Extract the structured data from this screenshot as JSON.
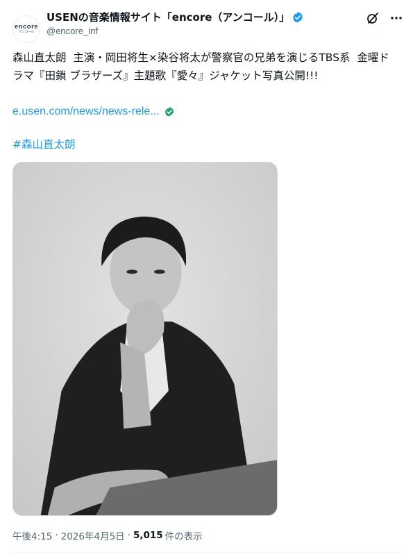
{
  "account": {
    "name": "USENの音楽情報サイト「encore（アンコール）」",
    "handle": "@encore_inf",
    "avatar_text": "encore",
    "avatar_subtext": "アンコール"
  },
  "tweet": {
    "text": "森山直太朗  主演・岡田将生×染谷将太が警察官の兄弟を演じるTBS系  金曜ドラマ『田鎖 ブラザーズ』主題歌『愛々』ジャケット写真公開!!!",
    "link": "e.usen.com/news/news-rele...",
    "hashtag": "#森山直太朗",
    "time": "午後4:15",
    "date": "2026年4月5日",
    "views_count": "5,015",
    "views_label": "件の表示"
  },
  "colors": {
    "accent": "#1d9bf0",
    "secondary_text": "#536471",
    "verified_check": "#1d9bf0",
    "link_check": "#25a06b"
  },
  "icons": {
    "grok": "grok-icon",
    "more": "more-icon",
    "verified": "verified-icon"
  }
}
